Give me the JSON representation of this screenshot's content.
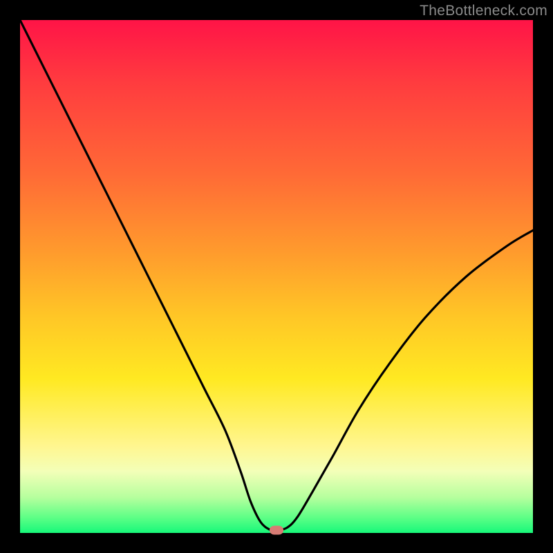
{
  "watermark": "TheBottleneck.com",
  "chart_data": {
    "type": "line",
    "title": "",
    "xlabel": "",
    "ylabel": "",
    "xlim": [
      0,
      100
    ],
    "ylim": [
      0,
      100
    ],
    "grid": false,
    "legend": false,
    "series": [
      {
        "name": "bottleneck-curve",
        "x": [
          0,
          4,
          8,
          12,
          16,
          20,
          24,
          28,
          32,
          36,
          40,
          43,
          45,
          47,
          49,
          50,
          52,
          54,
          57,
          61,
          66,
          72,
          79,
          87,
          95,
          100
        ],
        "y": [
          100,
          92,
          84,
          76,
          68,
          60,
          52,
          44,
          36,
          28,
          20,
          12,
          6,
          2,
          0.5,
          0.5,
          1,
          3,
          8,
          15,
          24,
          33,
          42,
          50,
          56,
          59
        ]
      }
    ],
    "marker": {
      "x": 50,
      "y": 0.5,
      "color": "#d77b74"
    },
    "background_gradient": {
      "direction": "vertical",
      "stops": [
        {
          "pos": 0.0,
          "color": "#ff1447"
        },
        {
          "pos": 0.3,
          "color": "#ff6a36"
        },
        {
          "pos": 0.58,
          "color": "#ffc726"
        },
        {
          "pos": 0.83,
          "color": "#fff68f"
        },
        {
          "pos": 0.97,
          "color": "#5dff86"
        },
        {
          "pos": 1.0,
          "color": "#17f87a"
        }
      ]
    }
  }
}
